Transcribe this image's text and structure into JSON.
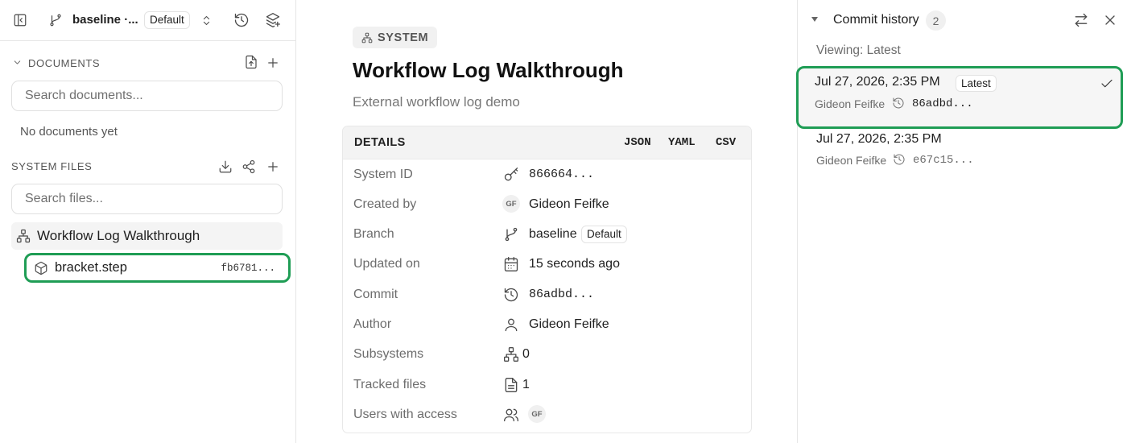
{
  "sidebar": {
    "branch": {
      "name": "baseline ·...",
      "badge": "Default"
    },
    "documents": {
      "label": "DOCUMENTS",
      "search_placeholder": "Search documents...",
      "empty_text": "No documents yet"
    },
    "system_files": {
      "label": "SYSTEM FILES",
      "search_placeholder": "Search files..."
    },
    "tree": {
      "system": {
        "label": "Workflow Log Walkthrough",
        "icon": "hierarchy-icon"
      },
      "file": {
        "label": "bracket.step",
        "hash": "fb6781...",
        "icon": "cube-icon"
      }
    }
  },
  "main": {
    "tag": "SYSTEM",
    "title": "Workflow Log Walkthrough",
    "subtitle": "External workflow log demo",
    "details": {
      "header": "DETAILS",
      "formats": [
        "JSON",
        "YAML",
        "CSV"
      ],
      "rows": [
        {
          "label": "System ID",
          "value": "866664...",
          "icon": "key-icon"
        },
        {
          "label": "Created by",
          "value": "Gideon Feifke",
          "avatar": "GF"
        },
        {
          "label": "Branch",
          "value": "baseline",
          "badge": "Default",
          "icon": "branch-icon"
        },
        {
          "label": "Updated on",
          "value": "15 seconds ago",
          "icon": "calendar-icon"
        },
        {
          "label": "Commit",
          "value": "86adbd...",
          "icon": "history-icon"
        },
        {
          "label": "Author",
          "value": "Gideon Feifke",
          "icon": "user-icon"
        },
        {
          "label": "Subsystems",
          "value": "0",
          "icon": "hierarchy-icon"
        },
        {
          "label": "Tracked files",
          "value": "1",
          "icon": "file-icon"
        },
        {
          "label": "Users with access",
          "avatar": "GF",
          "icon": "users-icon"
        }
      ]
    }
  },
  "history": {
    "title": "Commit history",
    "count": "2",
    "viewing": "Viewing: Latest",
    "commits": [
      {
        "date": "Jul 27, 2026, 2:35 PM",
        "badge": "Latest",
        "author": "Gideon Feifke",
        "hash": "86adbd...",
        "selected": true
      },
      {
        "date": "Jul 27, 2026, 2:35 PM",
        "author": "Gideon Feifke",
        "hash": "e67c15..."
      }
    ]
  },
  "colors": {
    "highlight": "#1f9d55",
    "muted_text": "#6d6d6d"
  }
}
